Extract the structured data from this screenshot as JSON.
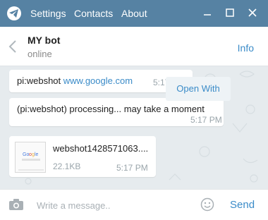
{
  "window": {
    "menu": [
      "Settings",
      "Contacts",
      "About"
    ],
    "icons": [
      "telegram-logo",
      "minimize",
      "maximize",
      "close"
    ]
  },
  "chat_header": {
    "name": "MY bot",
    "status": "online",
    "info_label": "Info"
  },
  "messages": [
    {
      "prefix": "pi:webshot ",
      "link": "www.google.com",
      "time": "5:17 PM"
    },
    {
      "text": "(pi:webshot) processing... may take a moment",
      "time": "5:17 PM"
    },
    {
      "filename": "webshot1428571063....",
      "size": "22.1KB",
      "time": "5:17 PM"
    }
  ],
  "open_with_label": "Open With",
  "composer": {
    "placeholder": "Write a message..",
    "send_label": "Send"
  },
  "colors": {
    "titlebar": "#5682a3",
    "accent": "#3a8bc8",
    "chat_bg": "#e6ebee"
  }
}
